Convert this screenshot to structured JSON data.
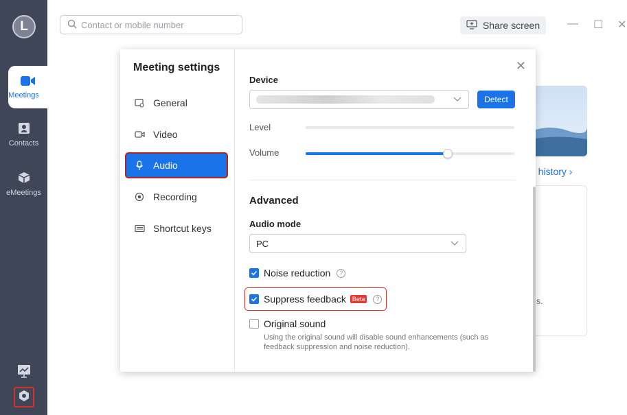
{
  "sidebar": {
    "logo_letter": "L",
    "items": [
      {
        "label": "Meetings",
        "icon": "video-camera-icon"
      },
      {
        "label": "Contacts",
        "icon": "contact-card-icon"
      },
      {
        "label": "eMeetings",
        "icon": "cube-icon"
      }
    ],
    "bottom": [
      {
        "icon": "whiteboard-icon"
      },
      {
        "icon": "gear-icon"
      }
    ]
  },
  "topbar": {
    "search_placeholder": "Contact or mobile number",
    "share_label": "Share screen",
    "window": {
      "minimize": "—",
      "maximize": "☐",
      "close": "✕"
    }
  },
  "background": {
    "history_link": "g history ›",
    "partial_text": "s."
  },
  "dialog": {
    "title": "Meeting settings",
    "close": "✕",
    "menu": [
      {
        "label": "General",
        "icon": "general-icon",
        "active": false
      },
      {
        "label": "Video",
        "icon": "video-icon",
        "active": false
      },
      {
        "label": "Audio",
        "icon": "microphone-icon",
        "active": true
      },
      {
        "label": "Recording",
        "icon": "record-icon",
        "active": false
      },
      {
        "label": "Shortcut keys",
        "icon": "keyboard-icon",
        "active": false
      }
    ],
    "device": {
      "label": "Device",
      "detect": "Detect",
      "level_label": "Level",
      "level_value": 0,
      "volume_label": "Volume",
      "volume_value": 0.68
    },
    "advanced": {
      "title": "Advanced",
      "audio_mode_label": "Audio mode",
      "audio_mode_value": "PC",
      "noise_reduction": {
        "label": "Noise reduction",
        "checked": true
      },
      "suppress_feedback": {
        "label": "Suppress feedback",
        "badge": "Beta",
        "checked": true
      },
      "original_sound": {
        "label": "Original sound",
        "checked": false,
        "note": "Using the original sound will disable sound enhancements (such as feedback suppression and noise reduction)."
      }
    }
  },
  "colors": {
    "accent": "#1a73e8",
    "sidebar": "#3f4658",
    "highlight": "#d93025"
  }
}
